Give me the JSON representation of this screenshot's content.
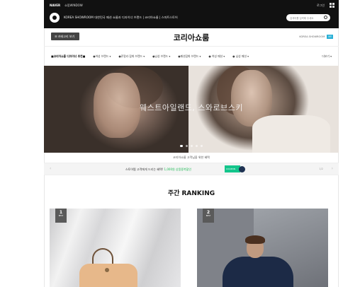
{
  "topbar": {
    "naver": "NAVER",
    "sub": "쇼핑WINDOW",
    "login": "로그인",
    "store_title": "KOREA SHOWROOM 대한민국 패션 쇼룸과 디자이너 브랜드 | 코리아쇼룸 | 스마트스토어",
    "search_placeholder": "검색어를 입력해 주세요"
  },
  "header": {
    "category_button": "☰ 카테고리 보기",
    "title": "코리아쇼룸",
    "right_text": "KOREA SHOWROOM",
    "right_badge": "MY"
  },
  "nav": {
    "items": [
      "■코리아쇼룸 디자이너 추천■",
      "●여성 브랜드 ▾",
      "●쥬얼리·잡화 브랜드 ▾",
      "●남성 브랜드 ▾",
      "●패션잡화 브랜드 ▾",
      "● 여성 패션 ▾",
      "● 남성 패션 ▾"
    ],
    "more": "더보기 ▾"
  },
  "hero": {
    "caption": "웨스트아일랜드, 스와로브스키"
  },
  "info_line": "코리아쇼룸 고객님을 위한 혜택",
  "promo": {
    "text_before": "스토어찜 고객에게 드리는 혜택! ",
    "text_highlight": "1,000원 상품중복할인",
    "coupon_label": "COUPON",
    "page": "1/2"
  },
  "ranking": {
    "title": "주간 RANKING",
    "cards": [
      {
        "rank": "1",
        "sub": "BEST"
      },
      {
        "rank": "2",
        "sub": "BEST"
      }
    ]
  }
}
